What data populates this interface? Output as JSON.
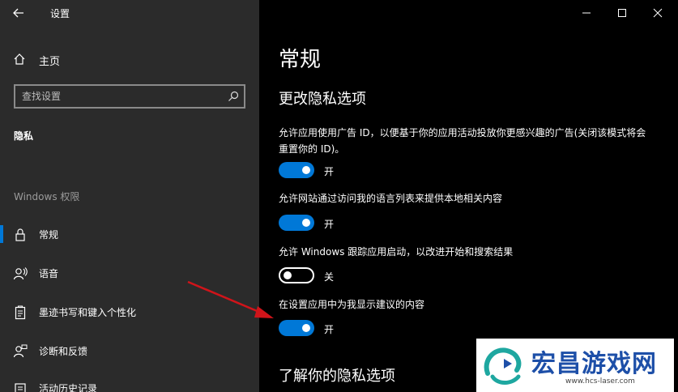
{
  "window": {
    "title": "设置"
  },
  "sidebar": {
    "home_label": "主页",
    "search_placeholder": "查找设置",
    "category_title": "隐私",
    "section_label": "Windows 权限",
    "items": [
      {
        "label": "常规",
        "icon": "lock-icon",
        "selected": true
      },
      {
        "label": "语音",
        "icon": "speech-icon",
        "selected": false
      },
      {
        "label": "墨迹书写和键入个性化",
        "icon": "clipboard-icon",
        "selected": false
      },
      {
        "label": "诊断和反馈",
        "icon": "feedback-icon",
        "selected": false
      },
      {
        "label": "活动历史记录",
        "icon": "history-icon",
        "selected": false
      }
    ]
  },
  "main": {
    "page_title": "常规",
    "sub_heading": "更改隐私选项",
    "options": [
      {
        "description": "允许应用使用广告 ID，以便基于你的应用活动投放你更感兴趣的广告(关闭该模式将会重置你的 ID)。",
        "state_label": "开",
        "on": true
      },
      {
        "description": "允许网站通过访问我的语言列表来提供本地相关内容",
        "state_label": "开",
        "on": true
      },
      {
        "description": "允许 Windows 跟踪应用启动，以改进开始和搜索结果",
        "state_label": "关",
        "on": false
      },
      {
        "description": "在设置应用中为我显示建议的内容",
        "state_label": "开",
        "on": true
      }
    ],
    "sub_heading_2": "了解你的隐私选项"
  },
  "watermark": {
    "text": "宏昌游戏网",
    "url": "www.hcs-laser.com"
  },
  "colors": {
    "accent": "#0078d7",
    "sidebar_bg": "#2b2b2b",
    "main_bg": "#000000",
    "annotation_arrow": "#d0141a"
  }
}
